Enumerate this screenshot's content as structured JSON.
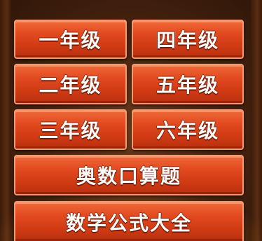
{
  "menu": {
    "grade1": "一年级",
    "grade4": "四年级",
    "grade2": "二年级",
    "grade5": "五年级",
    "grade3": "三年级",
    "grade6": "六年级",
    "olympiad": "奥数口算题",
    "formulas": "数学公式大全"
  },
  "colors": {
    "button_fill": "#d9431a",
    "button_border": "#f59a6e",
    "background": "#4a2410",
    "text": "#ffffff"
  }
}
